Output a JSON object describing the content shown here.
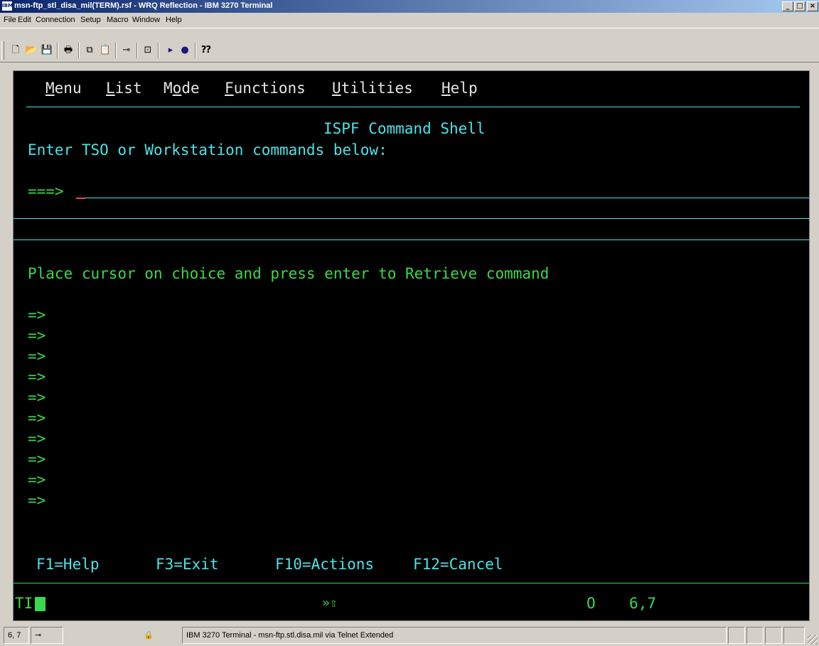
{
  "window": {
    "title": "msn-ftp_stl_disa_mil(TERM).rsf - WRQ Reflection - IBM 3270 Terminal",
    "app_icon_text": "IBM",
    "controls": {
      "minimize": "_",
      "maximize": "□",
      "close": "×"
    }
  },
  "menubar": [
    "File",
    "Edit",
    "Connection",
    "Setup",
    "Macro",
    "Window",
    "Help"
  ],
  "toolbar": {
    "icons": {
      "new": "🗋",
      "open": "📂",
      "save": "💾",
      "print": "🖶",
      "copy": "⧉",
      "paste": "📋",
      "connect": "⊸",
      "disconnect": "⊡",
      "play": "▸",
      "record": "●",
      "help": "⁇"
    }
  },
  "terminal": {
    "menu": {
      "menu": {
        "key": "M",
        "rest": "enu"
      },
      "list": {
        "key": "L",
        "rest": "ist"
      },
      "mode": {
        "pre": "M",
        "key": "o",
        "rest": "de"
      },
      "functions": {
        "key": "F",
        "rest": "unctions"
      },
      "utilities": {
        "key": "U",
        "rest": "tilities"
      },
      "help": {
        "key": "H",
        "rest": "elp"
      }
    },
    "panel_title": "ISPF Command Shell",
    "instruction": "Enter TSO or Workstation commands below:",
    "prompt": "===>",
    "retrieve_hint": "Place cursor on choice and press enter to Retrieve command",
    "history_prompts": [
      "=>",
      "=>",
      "=>",
      "=>",
      "=>",
      "=>",
      "=>",
      "=>",
      "=>",
      "=>"
    ],
    "function_keys": [
      "F1=Help",
      "F3=Exit",
      "F10=Actions",
      "F12=Cancel"
    ],
    "oia": {
      "indicator": "TI",
      "symbol": "»⇧",
      "mode": "O",
      "cursor_pos": "6,7"
    },
    "colors": {
      "cyan": "#4ce3e8",
      "green": "#3ad84d",
      "white": "#e6e6e6",
      "cursor": "#ff4040"
    }
  },
  "statusbar": {
    "cursor": "6, 7",
    "connect_icon": "connection-icon",
    "lock_icon": "lock-icon",
    "session": "IBM 3270 Terminal - msn-ftp.stl.disa.mil via Telnet Extended"
  }
}
